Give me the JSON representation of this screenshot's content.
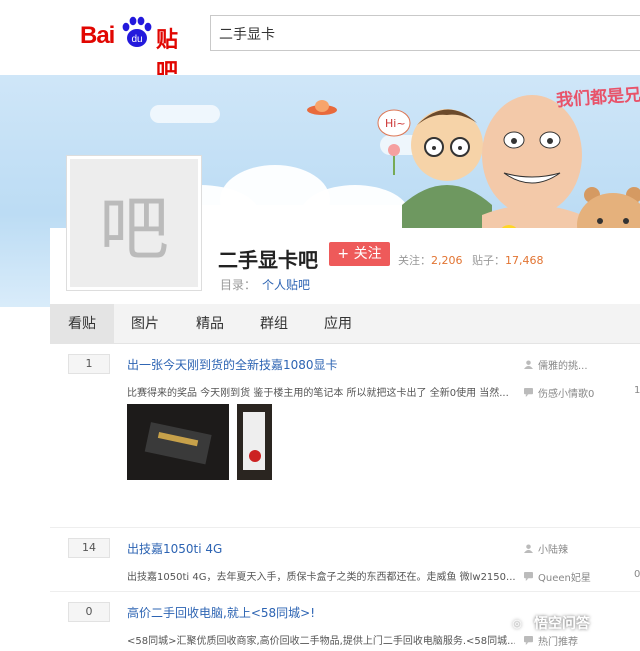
{
  "header": {
    "logo_bai": "Bai",
    "logo_du": "du",
    "logo_tieba": "贴吧",
    "search_value": "二手显卡"
  },
  "banner": {
    "slogan": "我们都是兄",
    "bubble": "Hi~"
  },
  "forum": {
    "avatar_char": "吧",
    "name": "二手显卡吧",
    "follow_label": "+ 关注",
    "followers_label": "关注：",
    "followers": "2,206",
    "posts_label": "贴子：",
    "posts": "17,468",
    "catalog_label": "目录：",
    "catalog_value": "个人贴吧"
  },
  "tabs": [
    "看贴",
    "图片",
    "精品",
    "群组",
    "应用"
  ],
  "posts": [
    {
      "replies": "1",
      "title": "出一张今天刚到货的全新技嘉1080显卡",
      "abstract": "比赛得来的奖品 今天刚到货 鉴于楼主用的笔记本 所以就把这卡出了 全新0使用 当然...",
      "author": "儒雅的挑...",
      "last_reply": "伤感小情歌0",
      "extra": "1"
    },
    {
      "replies": "14",
      "title": "出技嘉1050ti 4G",
      "abstract": "出技嘉1050ti 4G，去年夏天入手，质保卡盒子之类的东西都还在。走威鱼 微lw2150...",
      "author": "小陆辣",
      "last_reply": "Queen妃星",
      "extra": "0"
    },
    {
      "replies": "0",
      "title": "高价二手回收电脑,就上<58同城>!",
      "abstract": "<58同城>汇聚优质回收商家,高价回收二手物品,提供上门二手回收电脑服务.<58同城...",
      "author": "",
      "last_reply": "热门推荐",
      "extra": ""
    }
  ],
  "watermark": "悟空问答",
  "colors": {
    "brand_red": "#e10601",
    "link_blue": "#2d64b3",
    "follow_red": "#ee5a5a",
    "stat_orange": "#e27432"
  }
}
